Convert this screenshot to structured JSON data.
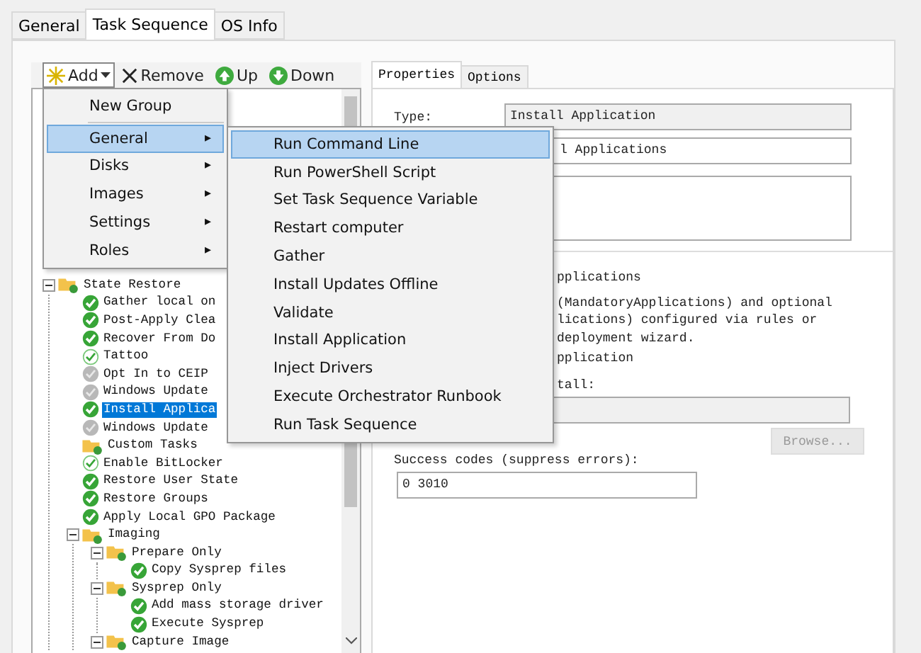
{
  "tabs": [
    {
      "label": "General",
      "selected": false
    },
    {
      "label": "Task Sequence",
      "selected": true
    },
    {
      "label": "OS Info",
      "selected": false
    }
  ],
  "toolbar": [
    {
      "label": "Add",
      "dropdown": true
    },
    {
      "label": "Remove",
      "dropdown": false
    },
    {
      "label": "Up",
      "dropdown": false
    },
    {
      "label": "Down",
      "dropdown": false
    }
  ],
  "tree": [
    {
      "label": "State Restore",
      "kind": "group",
      "expanded": true,
      "children": [
        {
          "label": "Gather local on",
          "kind": "check",
          "selected": false
        },
        {
          "label": "Post-Apply Clea",
          "kind": "check",
          "selected": false
        },
        {
          "label": "Recover From Do",
          "kind": "check",
          "selected": false
        },
        {
          "label": "Tattoo",
          "kind": "light-check",
          "selected": false
        },
        {
          "label": "Opt In to CEIP",
          "kind": "disabled",
          "selected": false
        },
        {
          "label": "Windows Update",
          "kind": "disabled",
          "selected": false
        },
        {
          "label": "Install Applica",
          "kind": "check",
          "selected": true
        },
        {
          "label": "Windows Update",
          "kind": "disabled",
          "selected": false
        },
        {
          "label": "Custom Tasks",
          "kind": "group",
          "selected": false
        },
        {
          "label": "Enable BitLocker",
          "kind": "light-check",
          "selected": false
        },
        {
          "label": "Restore User State",
          "kind": "check",
          "selected": false
        },
        {
          "label": "Restore Groups",
          "kind": "check",
          "selected": false
        },
        {
          "label": "Apply Local GPO Package",
          "kind": "check",
          "selected": false
        },
        {
          "label": "Imaging",
          "kind": "group",
          "expanded": true,
          "selected": false,
          "children": [
            {
              "label": "Prepare Only",
              "kind": "group",
              "expanded": true,
              "selected": false,
              "children": [
                {
                  "label": "Copy Sysprep files",
                  "kind": "check",
                  "selected": false
                }
              ]
            },
            {
              "label": "Sysprep Only",
              "kind": "group",
              "expanded": true,
              "selected": false,
              "children": [
                {
                  "label": "Add mass storage driver",
                  "kind": "check",
                  "selected": false
                },
                {
                  "label": "Execute Sysprep",
                  "kind": "check",
                  "selected": false
                }
              ]
            },
            {
              "label": "Capture Image",
              "kind": "group",
              "expanded": true,
              "selected": false
            }
          ]
        }
      ]
    }
  ],
  "properties": {
    "tabs": [
      {
        "label": "Properties",
        "selected": true
      },
      {
        "label": "Options",
        "selected": false
      }
    ],
    "type_label": "Type:",
    "type_value": "Install Application",
    "name_value": "l Applications",
    "heading": "pplications",
    "description_lines": [
      "(MandatoryApplications) and optional",
      "lications) configured via rules or",
      "deployment wizard."
    ],
    "option_label": "pplication",
    "install_label": "tall:",
    "browse": {
      "label": "Browse...",
      "disabled": true
    },
    "success_label": "Success codes (suppress errors):",
    "success_value": "0 3010"
  },
  "add_menu": [
    {
      "label": "New Group",
      "submenu": false,
      "selected": false
    },
    {
      "label": "General",
      "submenu": true,
      "selected": true
    },
    {
      "label": "Disks",
      "submenu": true,
      "selected": false
    },
    {
      "label": "Images",
      "submenu": true,
      "selected": false
    },
    {
      "label": "Settings",
      "submenu": true,
      "selected": false
    },
    {
      "label": "Roles",
      "submenu": true,
      "selected": false
    }
  ],
  "submenu_arrow": "▸",
  "general_menu": [
    {
      "label": "Run Command Line",
      "selected": true
    },
    {
      "label": "Run PowerShell Script",
      "selected": false
    },
    {
      "label": "Set Task Sequence Variable",
      "selected": false
    },
    {
      "label": "Restart computer",
      "selected": false
    },
    {
      "label": "Gather",
      "selected": false
    },
    {
      "label": "Install Updates Offline",
      "selected": false
    },
    {
      "label": "Validate",
      "selected": false
    },
    {
      "label": "Install Application",
      "selected": false
    },
    {
      "label": "Inject Drivers",
      "selected": false
    },
    {
      "label": "Execute Orchestrator Runbook",
      "selected": false
    },
    {
      "label": "Run Task Sequence",
      "selected": false
    }
  ]
}
